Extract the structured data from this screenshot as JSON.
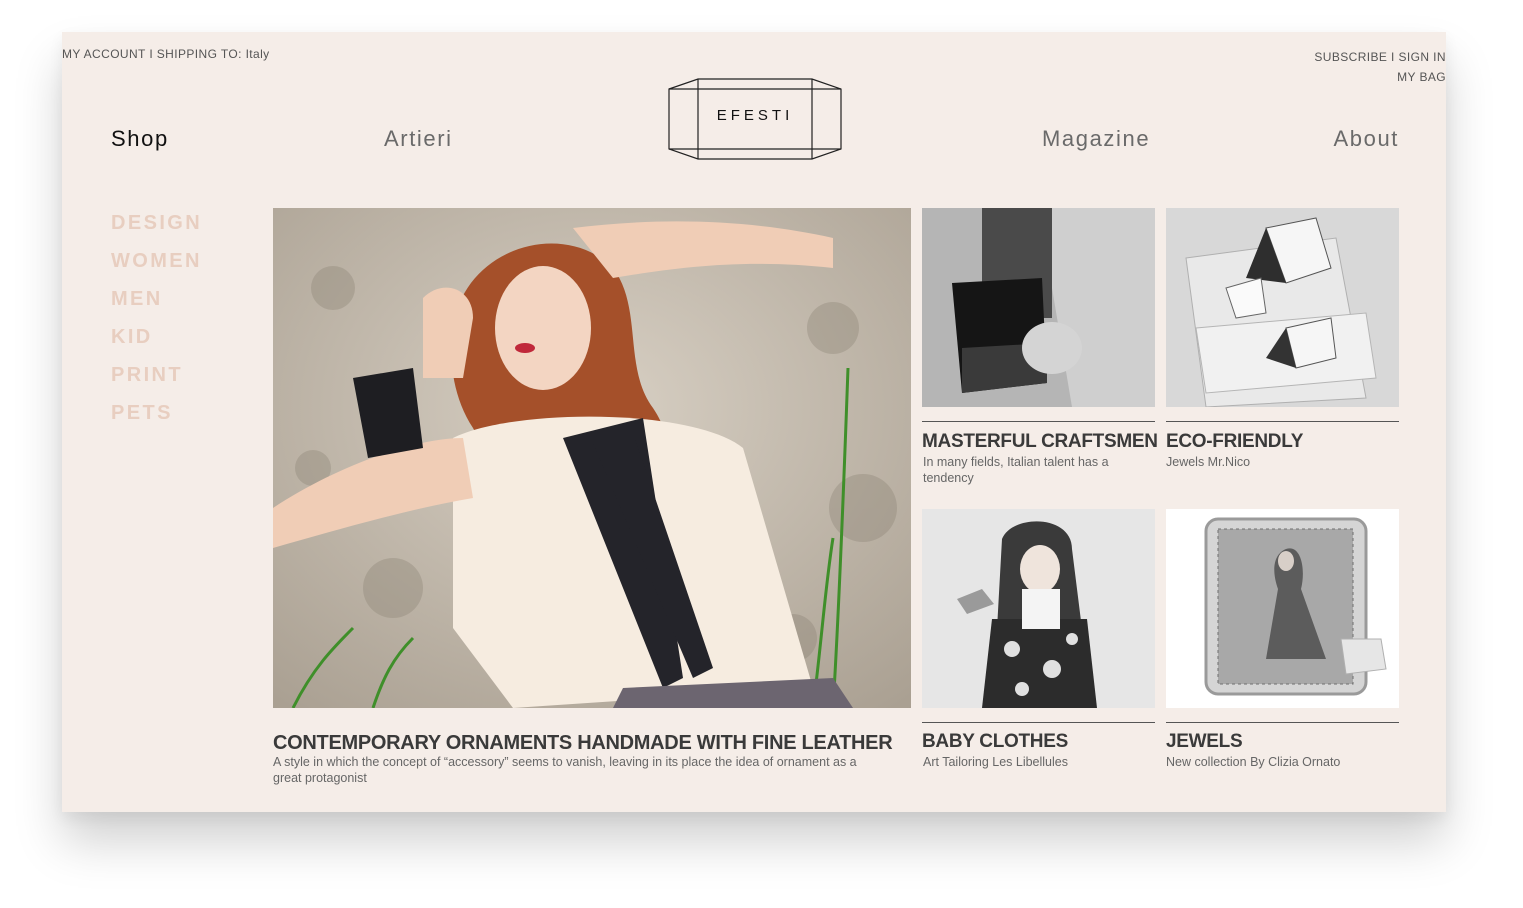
{
  "topbar": {
    "account": "MY ACCOUNT",
    "sep1": "I",
    "shipping_label": "SHIPPING TO:",
    "shipping_country": "Italy",
    "subscribe": "SUBSCRIBE",
    "sep2": "I",
    "sign_in": "SIGN IN",
    "bag": "MY BAG"
  },
  "nav": {
    "shop": "Shop",
    "artieri": "Artieri",
    "magazine": "Magazine",
    "about": "About"
  },
  "logo": {
    "text": "EFESTI"
  },
  "sidebar": {
    "categories": [
      "DESIGN",
      "WOMEN",
      "MEN",
      "KID",
      "PRINT",
      "PETS"
    ]
  },
  "hero": {
    "title": "CONTEMPORARY ORNAMENTS HANDMADE WITH FINE LEATHER",
    "subtitle_line1": "A style in which the concept of “accessory” seems to vanish, leaving in its place the idea of ornament as a",
    "subtitle_line2": "great protagonist"
  },
  "cards": [
    {
      "title": "MASTERFUL CRAFTSMEN",
      "sub_line1": "In many fields, Italian talent has a",
      "sub_line2": "tendency"
    },
    {
      "title": "ECO-FRIENDLY",
      "sub_line1": "Jewels Mr.Nico",
      "sub_line2": ""
    },
    {
      "title": "BABY CLOTHES",
      "sub_line1": "Art Tailoring Les Libellules",
      "sub_line2": ""
    },
    {
      "title": "JEWELS",
      "sub_line1": "New collection By Clizia Ornato",
      "sub_line2": ""
    }
  ],
  "colors": {
    "page_bg": "#f5ede8",
    "category": "#e8cec0",
    "title": "#3a3a3a"
  }
}
